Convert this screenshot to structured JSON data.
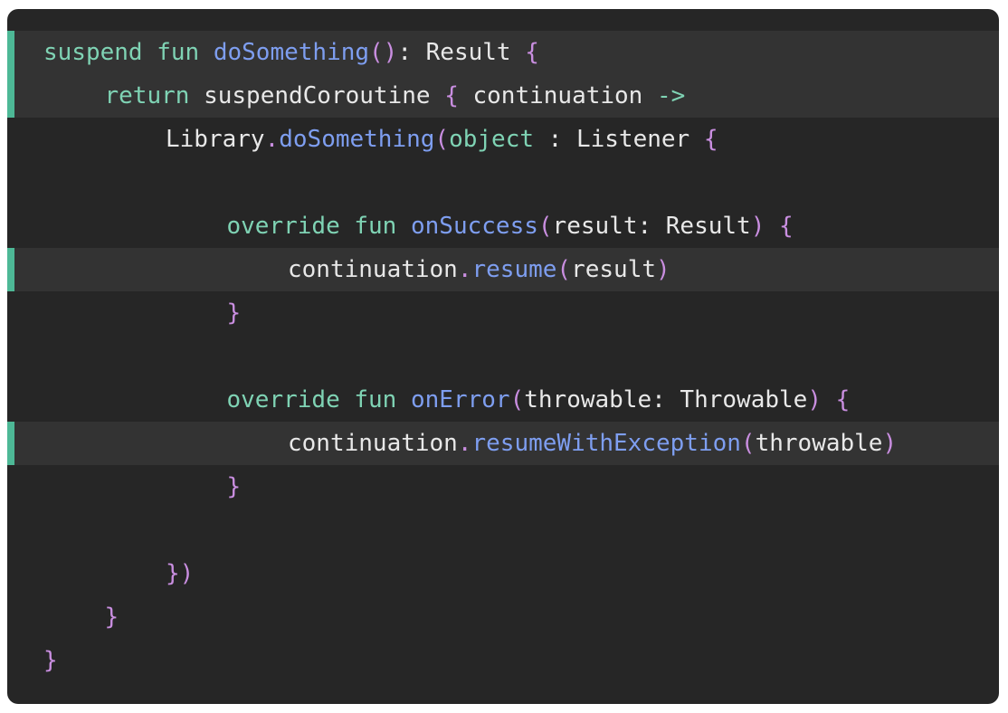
{
  "lines": [
    {
      "highlighted": true,
      "indent": 0,
      "tokens": [
        {
          "text": "suspend fun ",
          "kind": "keyword"
        },
        {
          "text": "doSomething",
          "kind": "function"
        },
        {
          "text": "()",
          "kind": "bracket"
        },
        {
          "text": ": Result ",
          "kind": "plain"
        },
        {
          "text": "{",
          "kind": "bracket"
        }
      ]
    },
    {
      "highlighted": true,
      "indent": 1,
      "tokens": [
        {
          "text": "return ",
          "kind": "keyword"
        },
        {
          "text": "suspendCoroutine ",
          "kind": "plain"
        },
        {
          "text": "{",
          "kind": "bracket"
        },
        {
          "text": " continuation ",
          "kind": "plain"
        },
        {
          "text": "->",
          "kind": "keyword"
        }
      ]
    },
    {
      "highlighted": false,
      "indent": 2,
      "tokens": [
        {
          "text": "Library",
          "kind": "plain"
        },
        {
          "text": ".",
          "kind": "bracket"
        },
        {
          "text": "doSomething",
          "kind": "function"
        },
        {
          "text": "(",
          "kind": "bracket"
        },
        {
          "text": "object",
          "kind": "keyword"
        },
        {
          "text": " : Listener ",
          "kind": "plain"
        },
        {
          "text": "{",
          "kind": "bracket"
        }
      ]
    },
    {
      "highlighted": false,
      "indent": 0,
      "tokens": []
    },
    {
      "highlighted": false,
      "indent": 3,
      "tokens": [
        {
          "text": "override fun ",
          "kind": "keyword"
        },
        {
          "text": "onSuccess",
          "kind": "function"
        },
        {
          "text": "(",
          "kind": "bracket"
        },
        {
          "text": "result: Result",
          "kind": "plain"
        },
        {
          "text": ") {",
          "kind": "bracket"
        }
      ]
    },
    {
      "highlighted": true,
      "indent": 4,
      "tokens": [
        {
          "text": "continuation",
          "kind": "plain"
        },
        {
          "text": ".",
          "kind": "bracket"
        },
        {
          "text": "resume",
          "kind": "function"
        },
        {
          "text": "(",
          "kind": "bracket"
        },
        {
          "text": "result",
          "kind": "plain"
        },
        {
          "text": ")",
          "kind": "bracket"
        }
      ]
    },
    {
      "highlighted": false,
      "indent": 3,
      "tokens": [
        {
          "text": "}",
          "kind": "bracket"
        }
      ]
    },
    {
      "highlighted": false,
      "indent": 0,
      "tokens": []
    },
    {
      "highlighted": false,
      "indent": 3,
      "tokens": [
        {
          "text": "override fun ",
          "kind": "keyword"
        },
        {
          "text": "onError",
          "kind": "function"
        },
        {
          "text": "(",
          "kind": "bracket"
        },
        {
          "text": "throwable: Throwable",
          "kind": "plain"
        },
        {
          "text": ") {",
          "kind": "bracket"
        }
      ]
    },
    {
      "highlighted": true,
      "indent": 4,
      "tokens": [
        {
          "text": "continuation",
          "kind": "plain"
        },
        {
          "text": ".",
          "kind": "bracket"
        },
        {
          "text": "resumeWithException",
          "kind": "function"
        },
        {
          "text": "(",
          "kind": "bracket"
        },
        {
          "text": "throwable",
          "kind": "plain"
        },
        {
          "text": ")",
          "kind": "bracket"
        }
      ]
    },
    {
      "highlighted": false,
      "indent": 3,
      "tokens": [
        {
          "text": "}",
          "kind": "bracket"
        }
      ]
    },
    {
      "highlighted": false,
      "indent": 0,
      "tokens": []
    },
    {
      "highlighted": false,
      "indent": 2,
      "tokens": [
        {
          "text": "})",
          "kind": "bracket"
        }
      ]
    },
    {
      "highlighted": false,
      "indent": 1,
      "tokens": [
        {
          "text": "}",
          "kind": "bracket"
        }
      ]
    },
    {
      "highlighted": false,
      "indent": 0,
      "tokens": [
        {
          "text": "}",
          "kind": "bracket"
        }
      ]
    }
  ],
  "colors": {
    "background": "#262626",
    "highlight_background": "#333333",
    "highlight_marker": "#4db896",
    "keyword": "#7fd3b4",
    "function": "#7e9ef0",
    "bracket": "#c98ee0",
    "plain": "#e8e8e8"
  }
}
